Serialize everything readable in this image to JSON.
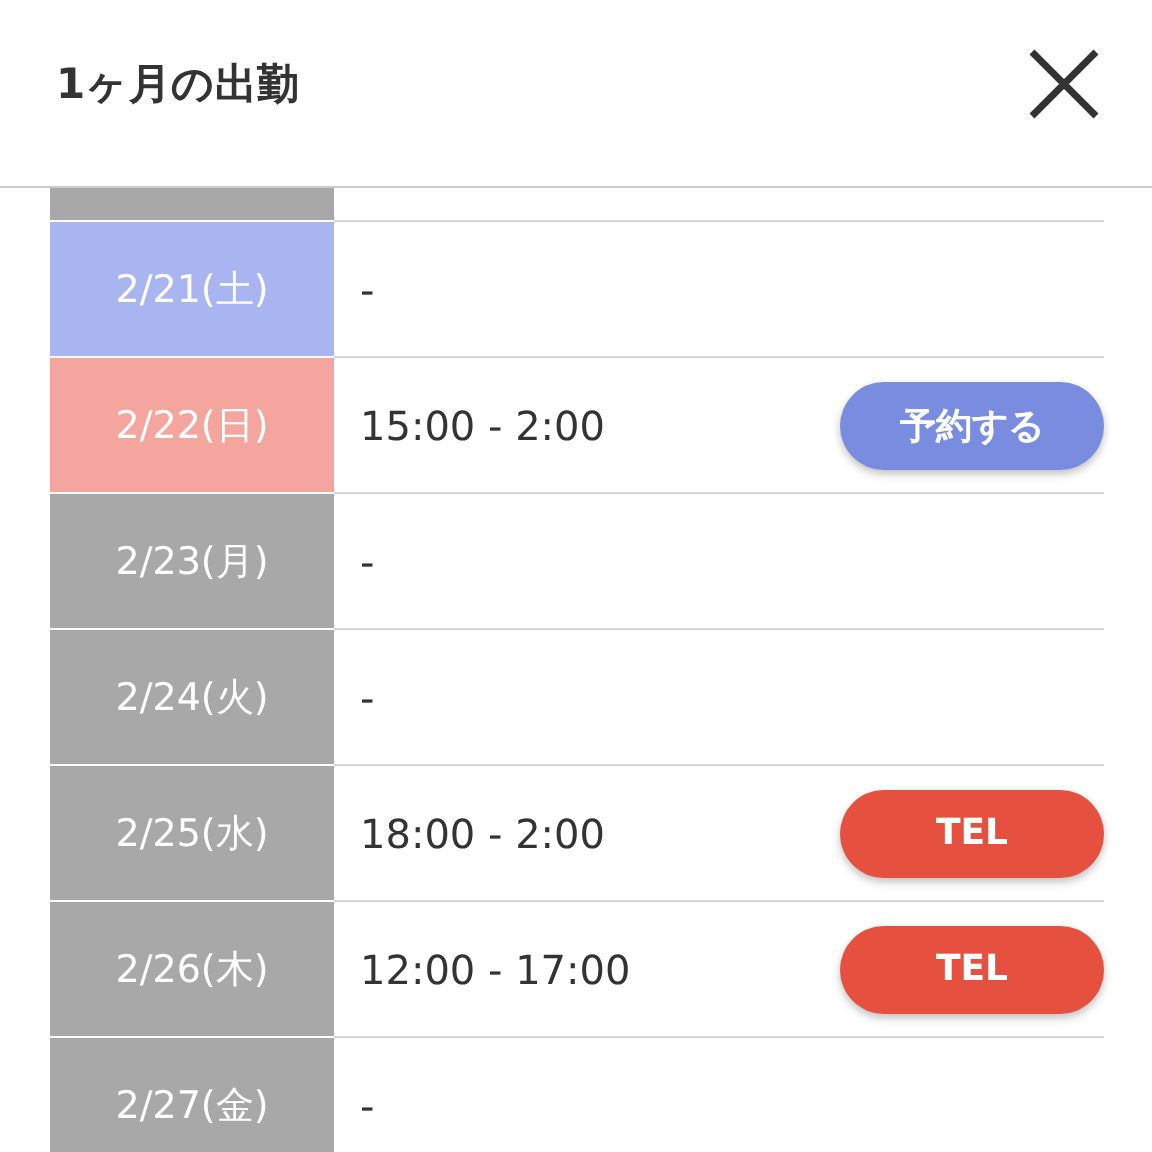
{
  "header": {
    "title": "1ヶ月の出勤"
  },
  "rows": [
    {
      "date": "2/21(土)",
      "color": "#a9b5f1",
      "time": "-"
    },
    {
      "date": "2/22(日)",
      "color": "#f3a59e",
      "time": "15:00 - 2:00",
      "button": {
        "kind": "reserve",
        "label": "予約する"
      }
    },
    {
      "date": "2/23(月)",
      "color": "#a8a8a8",
      "time": "-"
    },
    {
      "date": "2/24(火)",
      "color": "#a8a8a8",
      "time": "-"
    },
    {
      "date": "2/25(水)",
      "color": "#a8a8a8",
      "time": "18:00 - 2:00",
      "button": {
        "kind": "tel",
        "label": "TEL"
      }
    },
    {
      "date": "2/26(木)",
      "color": "#a8a8a8",
      "time": "12:00 - 17:00",
      "button": {
        "kind": "tel",
        "label": "TEL"
      }
    },
    {
      "date": "2/27(金)",
      "color": "#a8a8a8",
      "time": "-"
    }
  ]
}
